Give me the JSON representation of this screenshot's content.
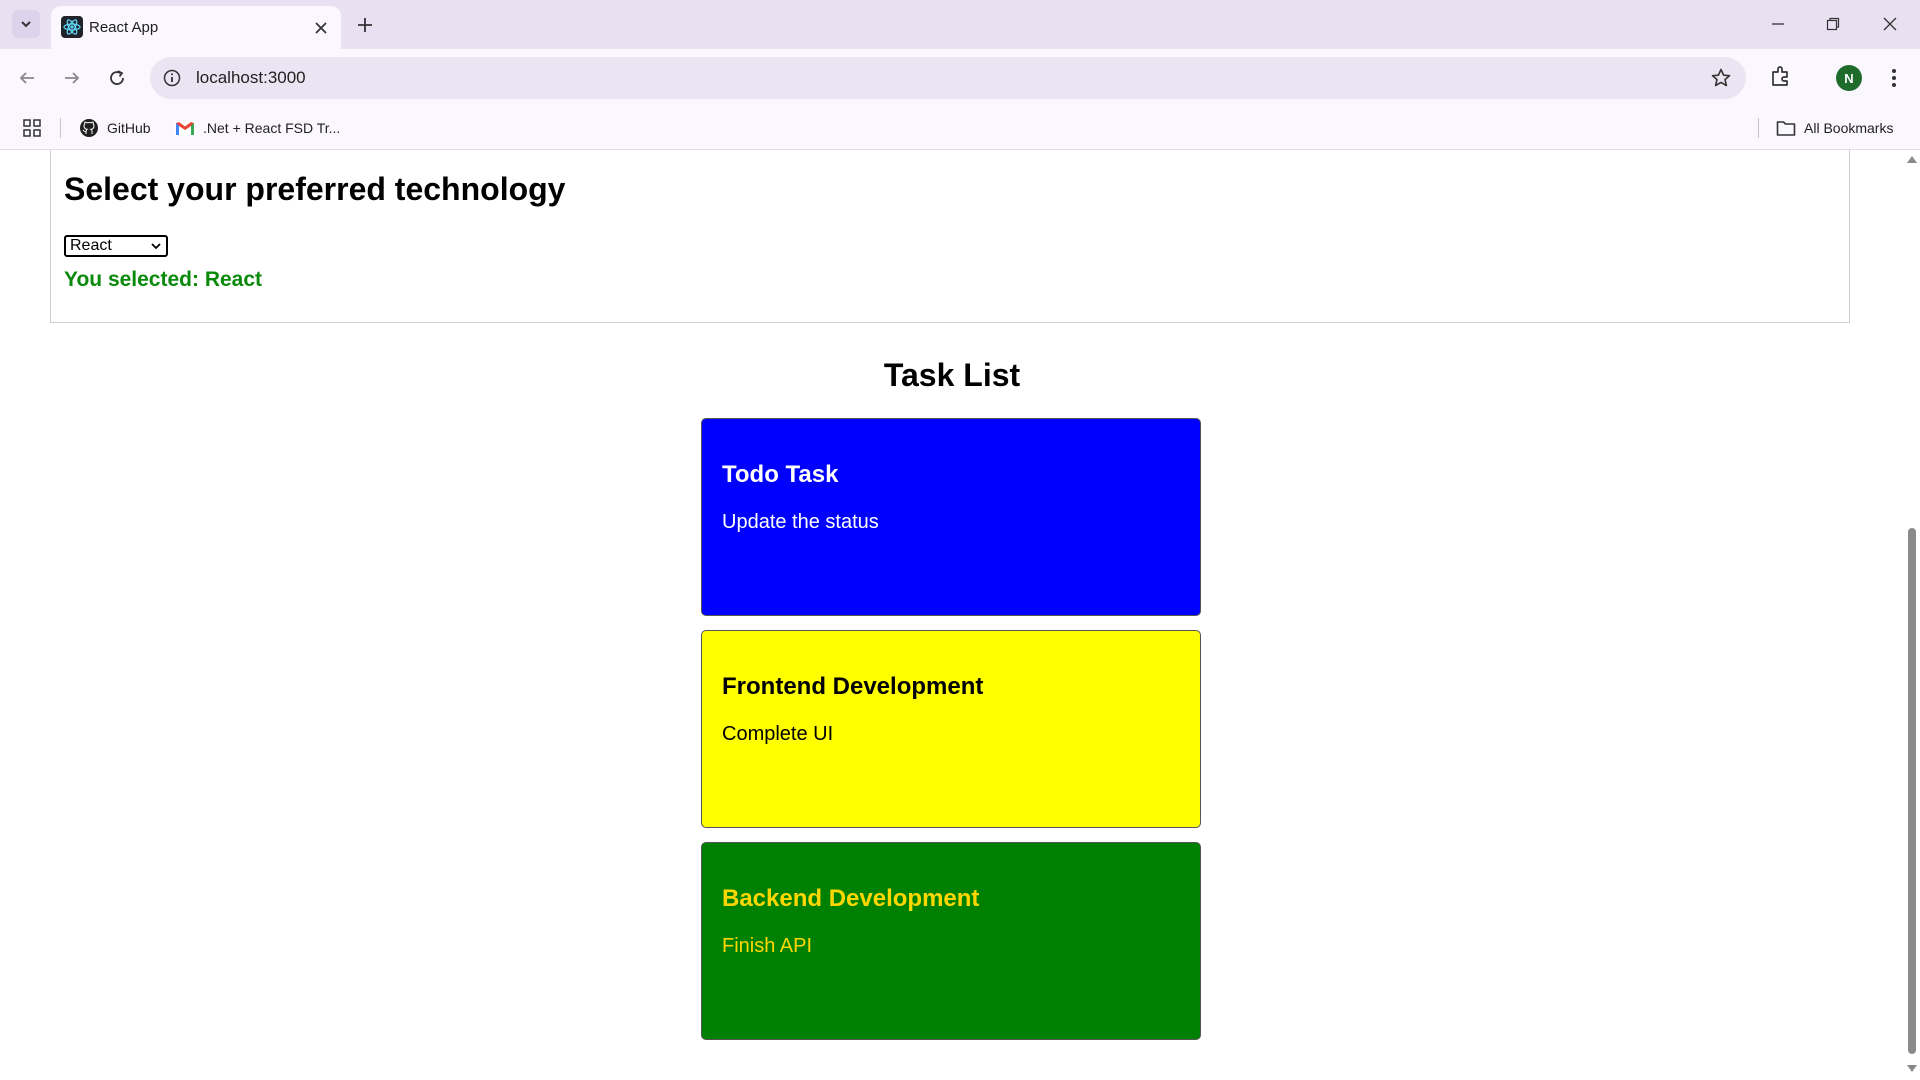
{
  "browser": {
    "tab_title": "React App",
    "url": "localhost:3000",
    "bookmarks": [
      {
        "label": "GitHub",
        "icon": "github-icon"
      },
      {
        "label": ".Net + React FSD Tr...",
        "icon": "gmail-icon"
      }
    ],
    "all_bookmarks_label": "All Bookmarks",
    "profile_initial": "N"
  },
  "tech_select": {
    "heading": "Select your preferred technology",
    "selected_value": "React",
    "result_text": "You selected: React",
    "result_color": "#0a8a0a"
  },
  "task_list": {
    "heading": "Task List",
    "tasks": [
      {
        "title": "Todo Task",
        "description": "Update the status",
        "bg": "#0000ff",
        "text_color": "#ffffff"
      },
      {
        "title": "Frontend Development",
        "description": "Complete UI",
        "bg": "#ffff00",
        "text_color": "#000000"
      },
      {
        "title": "Backend Development",
        "description": "Finish API",
        "bg": "#008000",
        "text_color": "#ffd700"
      }
    ]
  }
}
